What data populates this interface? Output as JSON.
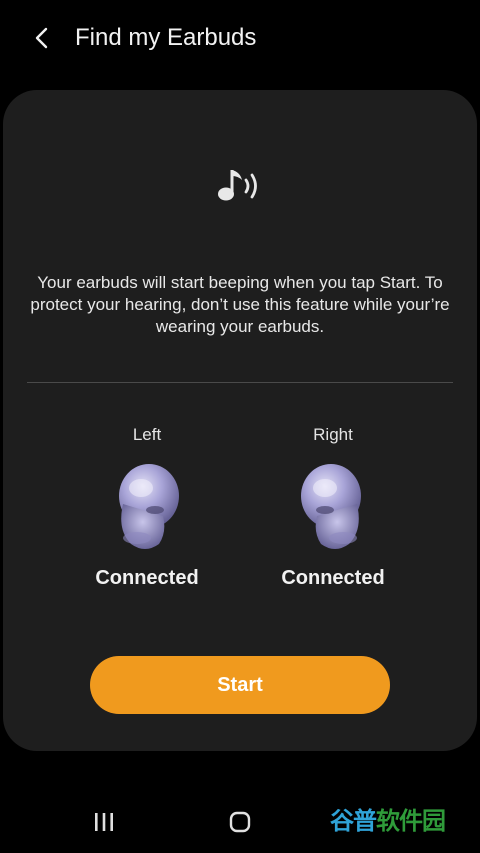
{
  "header": {
    "title": "Find my Earbuds",
    "back_icon": "chevron-left-icon"
  },
  "card": {
    "icon": "music-note-sound-icon",
    "description": "Your earbuds will start beeping when you tap Start. To protect your hearing, don’t use this feature while your’re wearing your earbuds.",
    "left": {
      "label": "Left",
      "status": "Connected"
    },
    "right": {
      "label": "Right",
      "status": "Connected"
    },
    "start_label": "Start"
  },
  "navbar": {
    "recents_icon": "recent-apps-icon",
    "home_icon": "home-icon"
  },
  "watermark": {
    "text_accent": "谷普",
    "text_rest": "软件园"
  },
  "colors": {
    "background": "#000000",
    "card": "#1e1e1e",
    "accent": "#f09a1e",
    "earbud": "#a7a3d6"
  }
}
